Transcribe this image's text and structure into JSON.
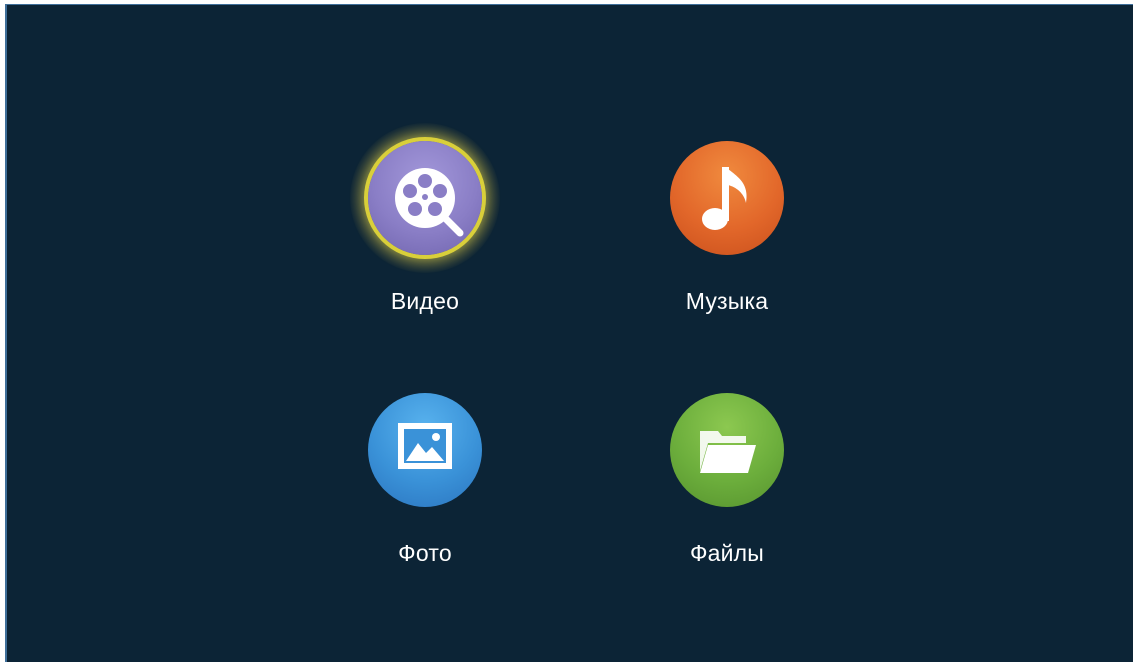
{
  "menu": {
    "items": [
      {
        "id": "video",
        "label": "Видео",
        "icon": "film-reel-icon",
        "color": "#8a7ec6",
        "selected": true
      },
      {
        "id": "music",
        "label": "Музыка",
        "icon": "music-note-icon",
        "color": "#e2672a",
        "selected": false
      },
      {
        "id": "photo",
        "label": "Фото",
        "icon": "picture-icon",
        "color": "#3a92d8",
        "selected": false
      },
      {
        "id": "files",
        "label": "Файлы",
        "icon": "folder-icon",
        "color": "#6cae3c",
        "selected": false
      }
    ]
  },
  "colors": {
    "background": "#0c2436",
    "selection_ring": "#d9cf3a"
  }
}
